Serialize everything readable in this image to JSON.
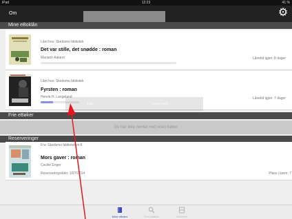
{
  "status_bar": {
    "device": "iPad",
    "wifi": "wifi-icon",
    "time": "12:23",
    "battery": "41 %"
  },
  "nav": {
    "left_label": "Om",
    "search_value": "",
    "gear": "gear-icon"
  },
  "sections": {
    "mine": "Mine eBoklån",
    "frie": "Frie eBøker",
    "reservasjoner": "Reserveringer"
  },
  "loans": [
    {
      "lender": "Lånt hos: Skedsmo bibliotek",
      "title": "Det var stille, det snødde : roman",
      "author": "Mariann Aaland",
      "return": "Lånetid igjen: 8 dager",
      "progress": 0
    },
    {
      "lender": "Lånt hos: Skedsmo bibliotek",
      "title": "Fyrsten : roman",
      "author": "Henrik H. Langeland",
      "return": "Lånetid igjen: 7 dager",
      "progress": 0.32
    }
  ],
  "download_overlay": {
    "left": "Lås",
    "right": "Laster ned"
  },
  "frie_message": "Du har ikke hentet ned noen bøker",
  "reservation": {
    "library": "Fra: Skedsmo bibliotek m.fl",
    "title": "Mors gaver : roman",
    "author": "Cecilie Enger",
    "date": "Reserveringsdato: 10/7/2014",
    "queue": "Plass i køen: 7"
  },
  "tabs": [
    {
      "label": "Mine eBøker",
      "icon": "book-icon",
      "active": true
    },
    {
      "label": "Finn eBøker",
      "icon": "search-icon",
      "active": false
    },
    {
      "label": "Arkiverte",
      "icon": "archive-icon",
      "active": false
    }
  ],
  "colors": {
    "accent": "#3a49c8",
    "progress": "#8a8fe8",
    "annotation": "#e8141e"
  }
}
